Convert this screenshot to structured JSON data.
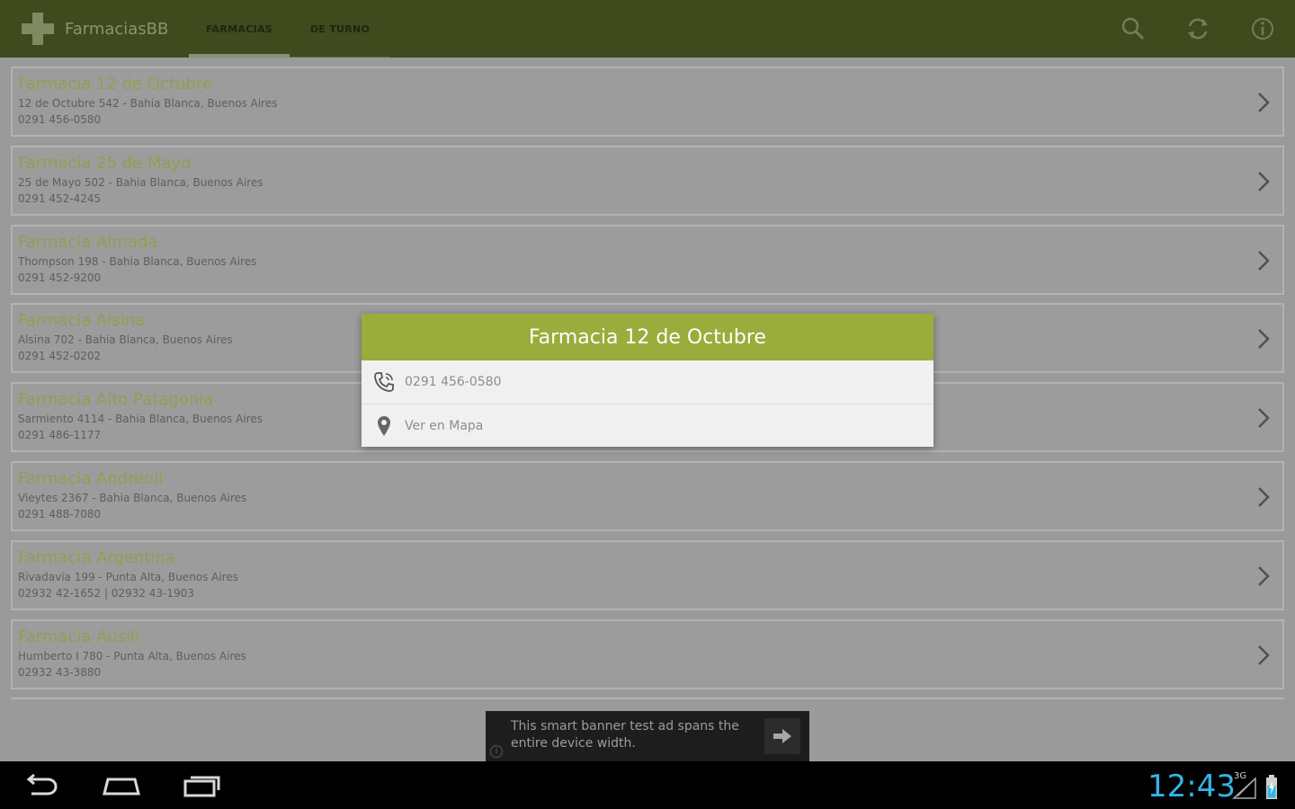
{
  "app": {
    "title": "FarmaciasBB",
    "brand_color": "#3f4a1d",
    "accent_color": "#9aac3b"
  },
  "tabs": [
    {
      "label": "FARMACIAS",
      "active": true
    },
    {
      "label": "DE TURNO",
      "active": false
    }
  ],
  "actions": [
    {
      "name": "search-icon"
    },
    {
      "name": "refresh-icon"
    },
    {
      "name": "info-icon"
    }
  ],
  "pharmacies": [
    {
      "name": "Farmacia 12 de Octubre",
      "address": "12 de Octubre 542 - Bahia Blanca, Buenos Aires",
      "phone": "0291 456-0580"
    },
    {
      "name": "Farmacia 25 de Mayo",
      "address": "25 de Mayo 502 - Bahia Blanca, Buenos Aires",
      "phone": "0291 452-4245"
    },
    {
      "name": "Farmacia Almada",
      "address": "Thompson 198 - Bahia Blanca, Buenos Aires",
      "phone": "0291 452-9200"
    },
    {
      "name": "Farmacia Alsina",
      "address": "Alsina 702 - Bahia Blanca, Buenos Aires",
      "phone": "0291 452-0202"
    },
    {
      "name": "Farmacia Alto Patagonia",
      "address": "Sarmiento 4114 - Bahia Blanca, Buenos Aires",
      "phone": "0291 486-1177"
    },
    {
      "name": "Farmacia Andreoli",
      "address": "Vieytes 2367 - Bahia Blanca, Buenos Aires",
      "phone": "0291 488-7080"
    },
    {
      "name": "Farmacia Argentina",
      "address": "Rivadavia 199 - Punta Alta, Buenos Aires",
      "phone": "02932 42-1652 | 02932 43-1903"
    },
    {
      "name": "Farmacia Ausili",
      "address": "Humberto I 780 - Punta Alta, Buenos Aires",
      "phone": "02932 43-3880"
    }
  ],
  "dialog": {
    "title": "Farmacia 12 de Octubre",
    "phone_label": "0291 456-0580",
    "map_label": "Ver en Mapa"
  },
  "ad": {
    "text": "This smart banner test ad spans the entire device width.",
    "info": "i"
  },
  "status": {
    "time": "12:43",
    "network": "3G"
  }
}
